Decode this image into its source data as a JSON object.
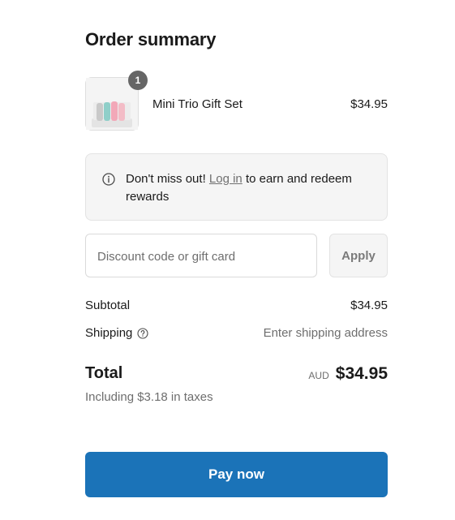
{
  "order_summary": {
    "title": "Order summary"
  },
  "line_item": {
    "quantity": "1",
    "name": "Mini Trio Gift Set",
    "price": "$34.95",
    "thumbnail_icon": "product-thumbnail-image"
  },
  "notice": {
    "icon": "info-icon",
    "text_before": "Don't miss out! ",
    "link_text": "Log in",
    "text_after": " to earn and redeem rewards"
  },
  "discount": {
    "placeholder": "Discount code or gift card",
    "value": "",
    "apply_label": "Apply"
  },
  "totals": {
    "subtotal_label": "Subtotal",
    "subtotal_value": "$34.95",
    "shipping_label": "Shipping",
    "shipping_help_icon": "question-circle-icon",
    "shipping_value": "Enter shipping address",
    "total_label": "Total",
    "total_currency": "AUD",
    "total_value": "$34.95",
    "taxes_note": "Including $3.18 in taxes"
  },
  "checkout": {
    "pay_label": "Pay now"
  },
  "colors": {
    "primary_button": "#1b73b8",
    "badge": "#666666",
    "notice_background": "#f5f5f5",
    "muted_text": "#6e6e6e"
  }
}
